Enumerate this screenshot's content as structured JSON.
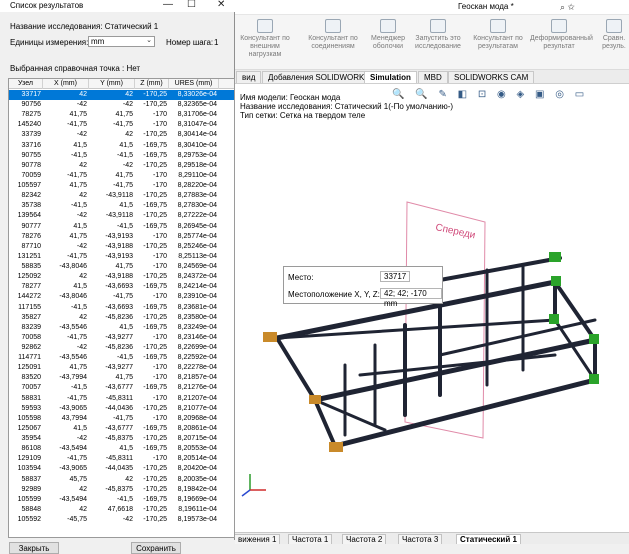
{
  "main_window": {
    "title": "Геоскан мода *",
    "ribbon": [
      "Консультант по внешним нагрузкам",
      "Консультант по соединениям",
      "Менеджер оболочки",
      "Запустить это исследование",
      "Консультант по результатам",
      "Деформированный результат",
      "Сравн. резуль."
    ],
    "tabs": [
      "вид",
      "Добавления SOLIDWORKS",
      "Simulation",
      "MBD",
      "SOLIDWORKS CAM"
    ],
    "model_info": [
      "Имя модели: Геоскан мода",
      "Название исследования: Статический 1(-По умолчанию-)",
      "Тип сетки: Сетка на твердом теле"
    ],
    "view_label": "Спереди",
    "bottom_tabs": [
      "вижения 1",
      "Частота 1",
      "Частота 2",
      "Частота 3",
      "Статический 1"
    ],
    "tooltip": {
      "place_label": "Место:",
      "place_value": "33717",
      "location_label": "Местоположение X, Y, Z:",
      "location_value": "42; 42; -170 mm"
    }
  },
  "dialog": {
    "title": "Список результатов",
    "study_name": "Название исследования: Статический 1",
    "units_label": "Единицы измерения:",
    "units_value": "mm",
    "step_label": "Номер шага:",
    "step_value": "1",
    "ref_point": "Выбранная справочная точка : Нет",
    "columns": [
      "Узел",
      "X (mm)",
      "Y (mm)",
      "Z (mm)",
      "URES (mm)"
    ],
    "rows": [
      [
        "33717",
        "42",
        "42",
        "-170,25",
        "8,33026e-04"
      ],
      [
        "90756",
        "-42",
        "-42",
        "-170,25",
        "8,32365e-04"
      ],
      [
        "78275",
        "41,75",
        "41,75",
        "-170",
        "8,31706e-04"
      ],
      [
        "145240",
        "-41,75",
        "-41,75",
        "-170",
        "8,31047e-04"
      ],
      [
        "33739",
        "-42",
        "42",
        "-170,25",
        "8,30414e-04"
      ],
      [
        "33716",
        "41,5",
        "41,5",
        "-169,75",
        "8,30410e-04"
      ],
      [
        "90755",
        "-41,5",
        "-41,5",
        "-169,75",
        "8,29753e-04"
      ],
      [
        "90778",
        "42",
        "-42",
        "-170,25",
        "8,29518e-04"
      ],
      [
        "70059",
        "-41,75",
        "41,75",
        "-170",
        "8,29110e-04"
      ],
      [
        "105597",
        "41,75",
        "-41,75",
        "-170",
        "8,28220e-04"
      ],
      [
        "82342",
        "42",
        "-43,9118",
        "-170,25",
        "8,27883e-04"
      ],
      [
        "35738",
        "-41,5",
        "41,5",
        "-169,75",
        "8,27830e-04"
      ],
      [
        "139564",
        "-42",
        "-43,9118",
        "-170,25",
        "8,27222e-04"
      ],
      [
        "90777",
        "41,5",
        "-41,5",
        "-169,75",
        "8,26945e-04"
      ],
      [
        "78276",
        "41,75",
        "-43,9193",
        "-170",
        "8,25774e-04"
      ],
      [
        "87710",
        "-42",
        "-43,9188",
        "-170,25",
        "8,25246e-04"
      ],
      [
        "131251",
        "-41,75",
        "-43,9193",
        "-170",
        "8,25113e-04"
      ],
      [
        "58835",
        "-43,8046",
        "41,75",
        "-170",
        "8,24569e-04"
      ],
      [
        "125092",
        "42",
        "-43,9188",
        "-170,25",
        "8,24372e-04"
      ],
      [
        "78277",
        "41,5",
        "-43,6693",
        "-169,75",
        "8,24214e-04"
      ],
      [
        "144272",
        "-43,8046",
        "-41,75",
        "-170",
        "8,23910e-04"
      ],
      [
        "117155",
        "-41,5",
        "-43,6693",
        "-169,75",
        "8,23681e-04"
      ],
      [
        "35827",
        "42",
        "-45,8236",
        "-170,25",
        "8,23580e-04"
      ],
      [
        "83239",
        "-43,5546",
        "41,5",
        "-169,75",
        "8,23249e-04"
      ],
      [
        "70058",
        "-41,75",
        "-43,9277",
        "-170",
        "8,23146e-04"
      ],
      [
        "92862",
        "-42",
        "-45,8236",
        "-170,25",
        "8,22699e-04"
      ],
      [
        "114771",
        "-43,5546",
        "-41,5",
        "-169,75",
        "8,22592e-04"
      ],
      [
        "125091",
        "41,75",
        "-43,9277",
        "-170",
        "8,22278e-04"
      ],
      [
        "83520",
        "-43,7994",
        "41,75",
        "-170",
        "8,21857e-04"
      ],
      [
        "70057",
        "-41,5",
        "-43,6777",
        "-169,75",
        "8,21276e-04"
      ],
      [
        "58831",
        "-41,75",
        "-45,8311",
        "-170",
        "8,21207e-04"
      ],
      [
        "59593",
        "-43,9065",
        "-44,0436",
        "-170,25",
        "8,21077e-04"
      ],
      [
        "105598",
        "43,7994",
        "-41,75",
        "-170",
        "8,20968e-04"
      ],
      [
        "125067",
        "41,5",
        "-43,6777",
        "-169,75",
        "8,20861e-04"
      ],
      [
        "35954",
        "-42",
        "-45,8375",
        "-170,25",
        "8,20715e-04"
      ],
      [
        "86108",
        "-43,5494",
        "41,5",
        "-169,75",
        "8,20553e-04"
      ],
      [
        "129109",
        "-41,75",
        "-45,8311",
        "-170",
        "8,20514e-04"
      ],
      [
        "103594",
        "-43,9065",
        "-44,0435",
        "-170,25",
        "8,20420e-04"
      ],
      [
        "58837",
        "45,75",
        "42",
        "-170,25",
        "8,20035e-04"
      ],
      [
        "92989",
        "42",
        "-45,8375",
        "-170,25",
        "8,19842e-04"
      ],
      [
        "105599",
        "-43,5494",
        "-41,5",
        "-169,75",
        "8,19669e-04"
      ],
      [
        "58848",
        "42",
        "47,6618",
        "-170,25",
        "8,19611e-04"
      ],
      [
        "105592",
        "-45,75",
        "-42",
        "-170,25",
        "8,19573e-04"
      ]
    ],
    "buttons": {
      "close": "Закрыть",
      "save": "Сохранить"
    }
  }
}
